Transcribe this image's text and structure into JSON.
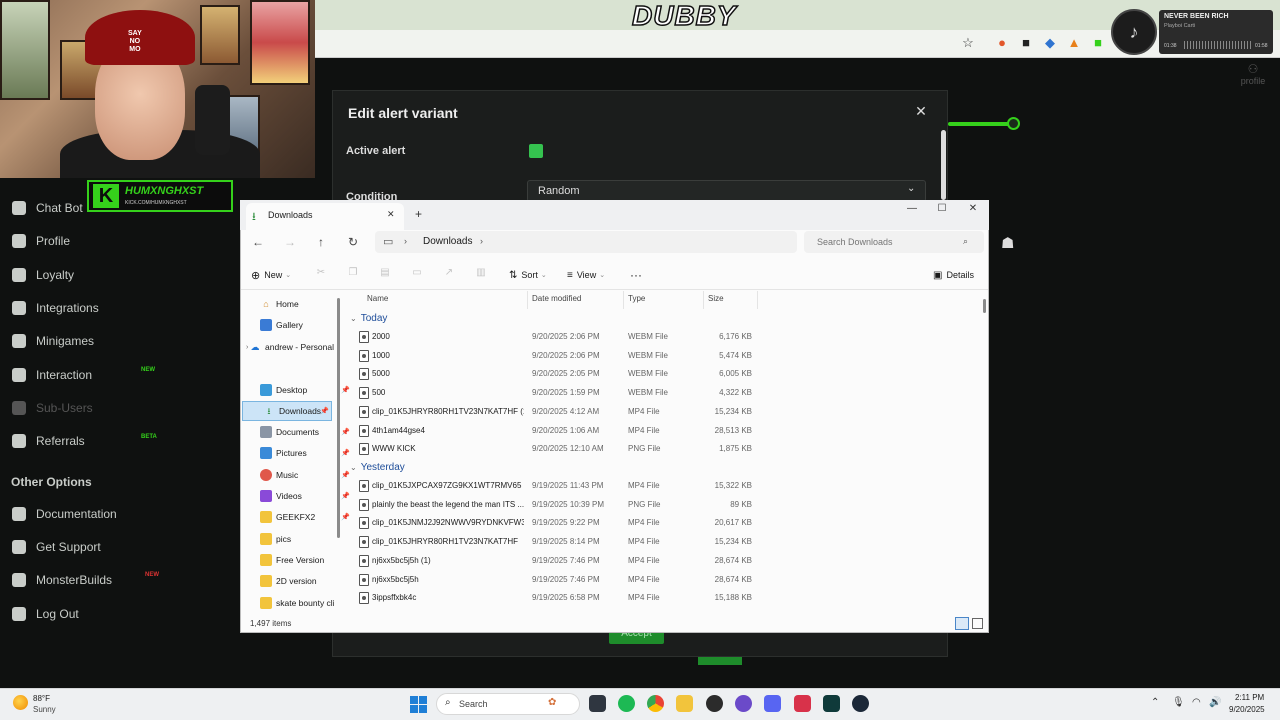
{
  "overlay": {
    "stream_title": "DUBBY",
    "cap_text": "SAY\nNO\nMO",
    "logo_name": "HUMXNGHXST",
    "logo_url": "KICK.COM/HUMXNGHXST",
    "music": {
      "title": "NEVER BEEN RICH",
      "artist": "Playboi Carti",
      "time_elapsed": "01:38",
      "time_total": "01:58",
      "icon": "music-note-icon"
    }
  },
  "site": {
    "profile_label": "profile",
    "nav": [
      {
        "label": "Chat Bot",
        "icon": "chat-bot-icon"
      },
      {
        "label": "Profile",
        "icon": "profile-icon"
      },
      {
        "label": "Loyalty",
        "icon": "trophy-icon"
      },
      {
        "label": "Integrations",
        "icon": "integrations-icon"
      },
      {
        "label": "Minigames",
        "icon": "gamepad-icon"
      },
      {
        "label": "Interaction",
        "icon": "music-icon"
      },
      {
        "label": "Sub-Users",
        "icon": "sub-users-icon"
      },
      {
        "label": "Referrals",
        "icon": "referrals-icon"
      }
    ],
    "badges": {
      "interaction": "NEW",
      "referrals": "BETA",
      "monsterbuilds": "NEW"
    },
    "other_options_title": "Other Options",
    "other_nav": [
      {
        "label": "Documentation",
        "icon": "documentation-icon"
      },
      {
        "label": "Get Support",
        "icon": "support-icon"
      },
      {
        "label": "MonsterBuilds",
        "icon": "monitor-icon"
      },
      {
        "label": "Log Out",
        "icon": "logout-icon"
      }
    ]
  },
  "modal": {
    "title": "Edit alert variant",
    "active_alert_label": "Active alert",
    "condition_label": "Condition",
    "condition_value": "Random",
    "accept_label": "Accept"
  },
  "explorer": {
    "tab_title": "Downloads",
    "path": "Downloads",
    "search_placeholder": "Search Downloads",
    "toolbar": {
      "new": "New",
      "sort": "Sort",
      "view": "View",
      "details": "Details"
    },
    "nav": [
      {
        "label": "Home",
        "icon": "home-icon"
      },
      {
        "label": "Gallery",
        "icon": "gallery-icon"
      },
      {
        "label": "andrew - Personal",
        "icon": "onedrive-icon"
      },
      {
        "label": "Desktop",
        "icon": "desktop-icon"
      },
      {
        "label": "Downloads",
        "icon": "downloads-icon"
      },
      {
        "label": "Documents",
        "icon": "documents-icon"
      },
      {
        "label": "Pictures",
        "icon": "pictures-icon"
      },
      {
        "label": "Music",
        "icon": "music-icon"
      },
      {
        "label": "Videos",
        "icon": "videos-icon"
      },
      {
        "label": "GEEKFX2",
        "icon": "folder-icon"
      },
      {
        "label": "pics",
        "icon": "folder-icon"
      },
      {
        "label": "Free Version",
        "icon": "folder-icon"
      },
      {
        "label": "2D version",
        "icon": "folder-icon"
      },
      {
        "label": "skate bounty clips",
        "icon": "folder-icon"
      }
    ],
    "columns": {
      "name": "Name",
      "date": "Date modified",
      "type": "Type",
      "size": "Size"
    },
    "groups": {
      "today": "Today",
      "yesterday": "Yesterday"
    },
    "today_files": [
      {
        "name": "2000",
        "date": "9/20/2025 2:06 PM",
        "type": "WEBM File",
        "size": "6,176 KB"
      },
      {
        "name": "1000",
        "date": "9/20/2025 2:06 PM",
        "type": "WEBM File",
        "size": "5,474 KB"
      },
      {
        "name": "5000",
        "date": "9/20/2025 2:05 PM",
        "type": "WEBM File",
        "size": "6,005 KB"
      },
      {
        "name": "500",
        "date": "9/20/2025 1:59 PM",
        "type": "WEBM File",
        "size": "4,322 KB"
      },
      {
        "name": "clip_01K5JHRYR80RH1TV23N7KAT7HF (1)",
        "date": "9/20/2025 4:12 AM",
        "type": "MP4 File",
        "size": "15,234 KB"
      },
      {
        "name": "4th1am44gse4",
        "date": "9/20/2025 1:06 AM",
        "type": "MP4 File",
        "size": "28,513 KB"
      },
      {
        "name": "WWW KICK",
        "date": "9/20/2025 12:10 AM",
        "type": "PNG File",
        "size": "1,875 KB"
      }
    ],
    "yesterday_files": [
      {
        "name": "clip_01K5JXPCAX97ZG9KX1WT7RMV65",
        "date": "9/19/2025 11:43 PM",
        "type": "MP4 File",
        "size": "15,322 KB"
      },
      {
        "name": "plainly the beast the legend the man ITS ...",
        "date": "9/19/2025 10:39 PM",
        "type": "PNG File",
        "size": "89 KB"
      },
      {
        "name": "clip_01K5JNMJ2J92NWWV9RYDNKVFW3",
        "date": "9/19/2025 9:22 PM",
        "type": "MP4 File",
        "size": "20,617 KB"
      },
      {
        "name": "clip_01K5JHRYR80RH1TV23N7KAT7HF",
        "date": "9/19/2025 8:14 PM",
        "type": "MP4 File",
        "size": "15,234 KB"
      },
      {
        "name": "nj6xx5bc5j5h (1)",
        "date": "9/19/2025 7:46 PM",
        "type": "MP4 File",
        "size": "28,674 KB"
      },
      {
        "name": "nj6xx5bc5j5h",
        "date": "9/19/2025 7:46 PM",
        "type": "MP4 File",
        "size": "28,674 KB"
      },
      {
        "name": "3ippsffxbk4c",
        "date": "9/19/2025 6:58 PM",
        "type": "MP4 File",
        "size": "15,188 KB"
      }
    ],
    "status_count": "1,497 items"
  },
  "taskbar": {
    "weather_temp": "88°F",
    "weather_cond": "Sunny",
    "search_label": "Search",
    "time": "2:11 PM",
    "date": "9/20/2025"
  },
  "colors": {
    "accent_green": "#35d11b",
    "button_green": "#1e8c2b",
    "explorer_selection": "#cce4f7"
  }
}
